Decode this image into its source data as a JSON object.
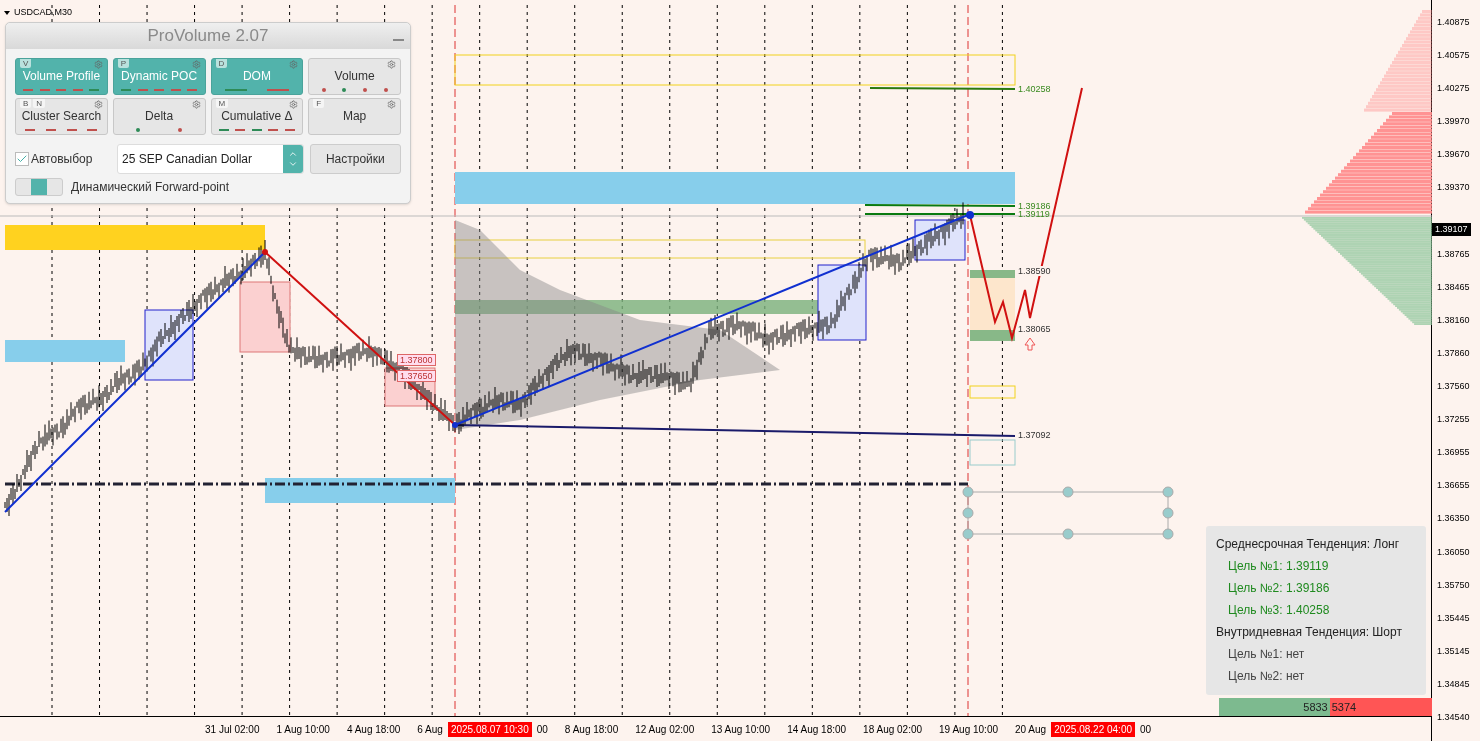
{
  "chart": {
    "symbol": "USDCAD,M30"
  },
  "panel": {
    "title": "ProVolume 2.07",
    "buttons": [
      {
        "label": "Volume Profile",
        "hotkeys": [
          "V"
        ],
        "active": true,
        "indicators": [
          {
            "kind": "dash",
            "color": "#c0504d"
          },
          {
            "kind": "dash",
            "color": "#c0504d"
          },
          {
            "kind": "dash",
            "color": "#c0504d"
          },
          {
            "kind": "dash",
            "color": "#c0504d"
          },
          {
            "kind": "dash",
            "color": "#2e8b57"
          }
        ]
      },
      {
        "label": "Dynamic POC",
        "hotkeys": [
          "P"
        ],
        "active": true,
        "indicators": [
          {
            "kind": "dash",
            "color": "#2e8b57"
          },
          {
            "kind": "dash",
            "color": "#c0504d"
          },
          {
            "kind": "dash",
            "color": "#c0504d"
          },
          {
            "kind": "dash",
            "color": "#c0504d"
          },
          {
            "kind": "dash",
            "color": "#c0504d"
          }
        ]
      },
      {
        "label": "DOM",
        "hotkeys": [
          "D"
        ],
        "active": true,
        "indicators": [
          {
            "kind": "dash",
            "color": "#2e8b57"
          },
          {
            "kind": "dash",
            "color": "#c0504d"
          }
        ]
      },
      {
        "label": "Volume",
        "active": false,
        "indicators": [
          {
            "kind": "dot",
            "color": "#c0504d"
          },
          {
            "kind": "dot",
            "color": "#2e8b57"
          },
          {
            "kind": "dot",
            "color": "#c0504d"
          },
          {
            "kind": "dot",
            "color": "#c0504d"
          }
        ]
      },
      {
        "label": "Cluster Search",
        "hotkeys": [
          "B",
          "N"
        ],
        "active": false,
        "indicators": [
          {
            "kind": "dash",
            "color": "#c0504d"
          },
          {
            "kind": "dash",
            "color": "#c0504d"
          },
          {
            "kind": "dash",
            "color": "#c0504d"
          },
          {
            "kind": "dash",
            "color": "#c0504d"
          }
        ]
      },
      {
        "label": "Delta",
        "active": false,
        "indicators": [
          {
            "kind": "dot",
            "color": "#2e8b57"
          },
          {
            "kind": "dot",
            "color": "#c0504d"
          }
        ]
      },
      {
        "label": "Cumulative Δ",
        "hotkeys": [
          "M"
        ],
        "active": false,
        "indicators": [
          {
            "kind": "dash",
            "color": "#2e8b57"
          },
          {
            "kind": "dash",
            "color": "#c0504d"
          },
          {
            "kind": "dash",
            "color": "#2e8b57"
          },
          {
            "kind": "dash",
            "color": "#c0504d"
          },
          {
            "kind": "dash",
            "color": "#c0504d"
          }
        ]
      },
      {
        "label": "Map",
        "hotkeys": [
          "F"
        ],
        "active": false
      }
    ],
    "autoselect": {
      "label": "Автовыбор",
      "checked": true
    },
    "instrument": {
      "value": "25 SEP Canadian Dollar"
    },
    "settings_button": "Настройки",
    "forward_point": {
      "label": "Динамический Forward-point",
      "on": true
    }
  },
  "levels": [
    {
      "label": "1.40258",
      "kind": "target"
    },
    {
      "label": "1.39186",
      "kind": "target"
    },
    {
      "label": "1.39119",
      "kind": "target"
    },
    {
      "label": "1.38590",
      "kind": "plain"
    },
    {
      "label": "1.38065",
      "kind": "plain"
    },
    {
      "label": "1.37092",
      "kind": "plain"
    },
    {
      "label": "1.37800",
      "kind": "boxed"
    },
    {
      "label": "1.37650",
      "kind": "boxed"
    }
  ],
  "price_axis": {
    "ticks": [
      "1.40875",
      "1.40575",
      "1.40275",
      "1.39970",
      "1.39670",
      "1.39370",
      "1.38765",
      "1.38465",
      "1.38160",
      "1.37860",
      "1.37560",
      "1.37255",
      "1.36955",
      "1.36655",
      "1.36350",
      "1.36050",
      "1.35750",
      "1.35445",
      "1.35145",
      "1.34845",
      "1.34540"
    ],
    "current": "1.39107"
  },
  "time_axis": [
    {
      "label": "31 Jul 02:00",
      "kind": "tick"
    },
    {
      "label": "1 Aug 10:00",
      "kind": "tick"
    },
    {
      "label": "4 Aug 18:00",
      "kind": "tick"
    },
    {
      "label": "6 Aug",
      "kind": "tick"
    },
    {
      "label": "2025.08.07 10:30",
      "kind": "marker"
    },
    {
      "label": "00",
      "kind": "tick"
    },
    {
      "label": "8 Aug 18:00",
      "kind": "tick"
    },
    {
      "label": "12 Aug 02:00",
      "kind": "tick"
    },
    {
      "label": "13 Aug 10:00",
      "kind": "tick"
    },
    {
      "label": "14 Aug 18:00",
      "kind": "tick"
    },
    {
      "label": "18 Aug 02:00",
      "kind": "tick"
    },
    {
      "label": "19 Aug 10:00",
      "kind": "tick"
    },
    {
      "label": "20 Aug",
      "kind": "tick"
    },
    {
      "label": "2025.08.22 04:00",
      "kind": "marker"
    },
    {
      "label": "00",
      "kind": "tick"
    }
  ],
  "info": {
    "lines": [
      {
        "text": "Среднесрочная Тенденция: Лонг",
        "kind": "heading",
        "color": "#222222"
      },
      {
        "text": "Цель №1: 1.39119",
        "kind": "target",
        "color": "#1f8a1f"
      },
      {
        "text": "Цель №2: 1.39186",
        "kind": "target",
        "color": "#1f8a1f"
      },
      {
        "text": "Цель №3: 1.40258",
        "kind": "target",
        "color": "#1f8a1f"
      },
      {
        "text": "Внутридневная Тенденция: Шорт",
        "kind": "heading",
        "color": "#222222"
      },
      {
        "text": "Цель №1: нет",
        "kind": "target",
        "color": "#444444"
      },
      {
        "text": "Цель №2: нет",
        "kind": "target",
        "color": "#444444"
      }
    ],
    "buy": "5833",
    "sell": "5374",
    "level": 0.52
  }
}
